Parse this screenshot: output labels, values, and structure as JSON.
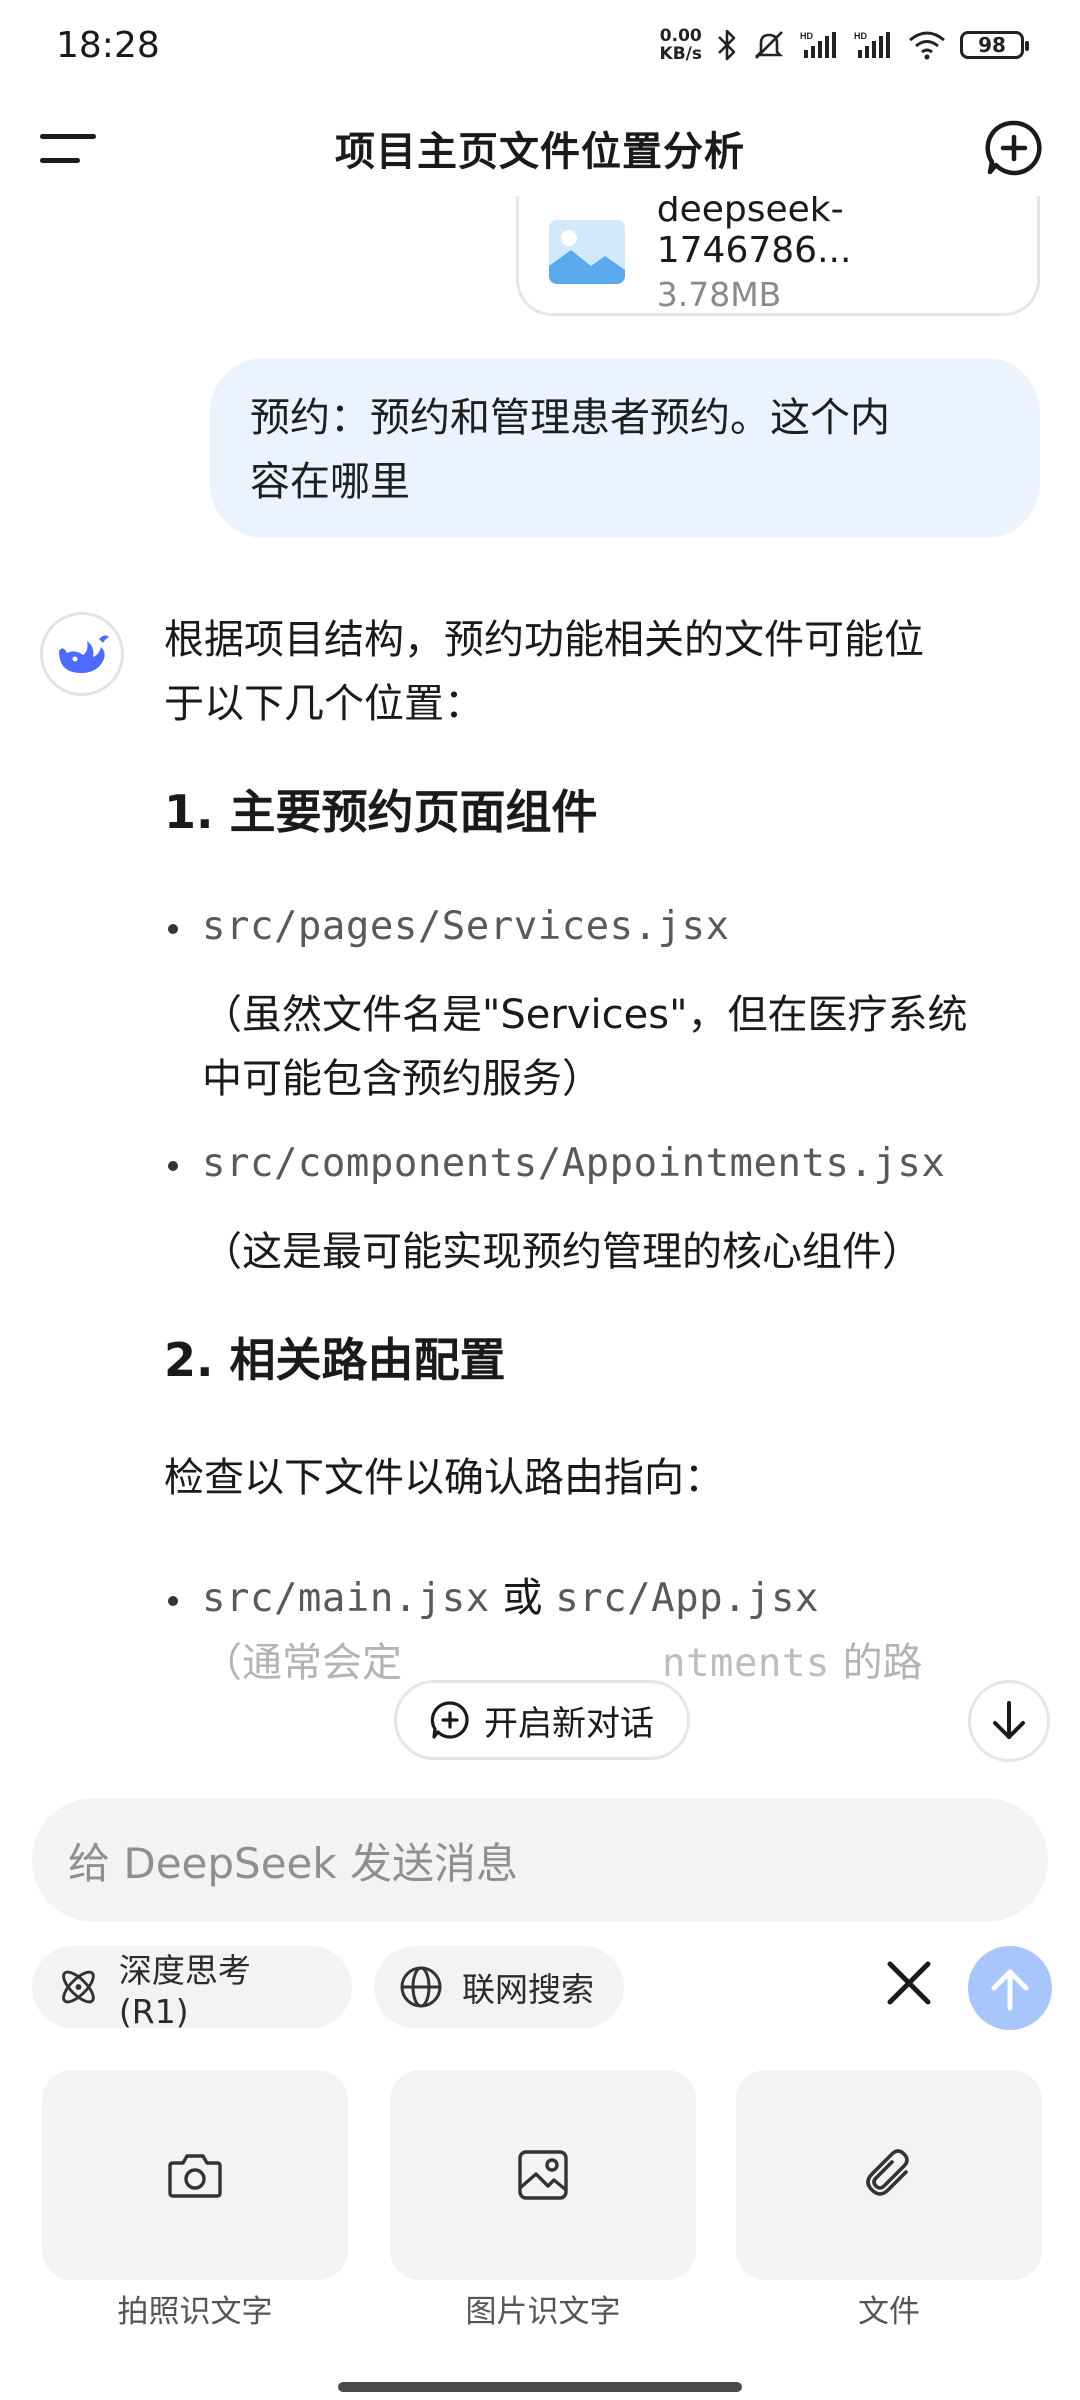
{
  "status_bar": {
    "time": "18:28",
    "speed_value": "0.00",
    "speed_unit": "KB/s",
    "battery": "98"
  },
  "header": {
    "title": "项目主页文件位置分析"
  },
  "file_card": {
    "name": "deepseek-1746786...",
    "size": "3.78MB"
  },
  "user_message": {
    "line1": "预约：预约和管理患者预约。这个内",
    "line2": "容在哪里"
  },
  "ai_response": {
    "intro_line1": "根据项目结构，预约功能相关的文件可能位",
    "intro_line2": "于以下几个位置：",
    "section1_title": "1. 主要预约页面组件",
    "item1_code": "src/pages/Services.jsx",
    "item1_note_line1": "（虽然文件名是\"Services\"，但在医疗系统",
    "item1_note_line2": "中可能包含预约服务）",
    "item2_code": "src/components/Appointments.jsx",
    "item2_note": "（这是最可能实现预约管理的核心组件）",
    "section2_title": "2. 相关路由配置",
    "section2_text": "检查以下文件以确认路由指向：",
    "item3_code_a": "src/main.jsx",
    "item3_or": "或",
    "item3_code_b": "src/App.jsx",
    "item3_note_partial_a": "（通常会定",
    "item3_note_partial_code": "ntments",
    "item3_note_partial_b": "的路"
  },
  "new_chat_chip": "开启新对话",
  "input": {
    "placeholder": "给 DeepSeek 发送消息"
  },
  "options": {
    "deep_think": "深度思考 (R1)",
    "web_search": "联网搜索"
  },
  "tiles": [
    {
      "label": "拍照识文字",
      "icon": "camera-icon"
    },
    {
      "label": "图片识文字",
      "icon": "image-icon"
    },
    {
      "label": "文件",
      "icon": "paperclip-icon"
    }
  ],
  "colors": {
    "user_bubble": "#edf3fe",
    "send_button": "#a9c6fb",
    "accent_blue": "#4d6bfe"
  }
}
